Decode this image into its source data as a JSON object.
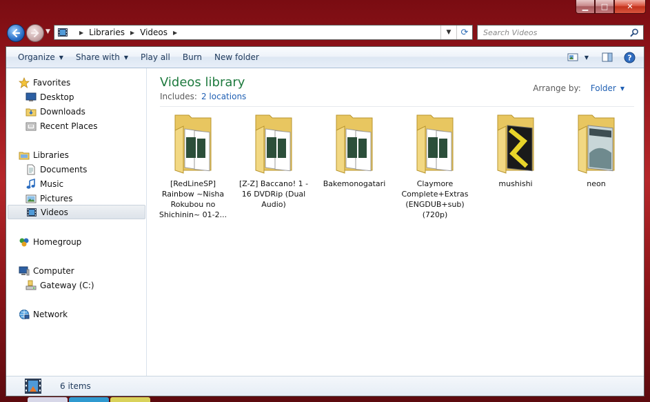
{
  "window": {
    "controls": {
      "minimize": "▁",
      "maximize": "□",
      "close": "✕"
    }
  },
  "address": {
    "crumbs": [
      "Libraries",
      "Videos"
    ],
    "dropdown_glyph": "▼",
    "refresh_glyph": "⟳"
  },
  "search": {
    "placeholder": "Search Videos"
  },
  "toolbar": {
    "organize": "Organize",
    "share_with": "Share with",
    "play_all": "Play all",
    "burn": "Burn",
    "new_folder": "New folder"
  },
  "nav": {
    "favorites": "Favorites",
    "desktop": "Desktop",
    "downloads": "Downloads",
    "recent_places": "Recent Places",
    "libraries": "Libraries",
    "documents": "Documents",
    "music": "Music",
    "pictures": "Pictures",
    "videos": "Videos",
    "homegroup": "Homegroup",
    "computer": "Computer",
    "gateway": "Gateway (C:)",
    "network": "Network"
  },
  "library": {
    "title": "Videos library",
    "includes_label": "Includes:",
    "locations_link": "2 locations",
    "arrange_label": "Arrange by:",
    "arrange_value": "Folder"
  },
  "folders": [
    {
      "name": "[RedLineSP] Rainbow ~Nisha Rokubou no Shichinin~ 01-2...",
      "thumb": "video"
    },
    {
      "name": "[Z-Z] Baccano! 1 - 16 DVDRip (Dual Audio)",
      "thumb": "video"
    },
    {
      "name": "Bakemonogatari",
      "thumb": "video"
    },
    {
      "name": "Claymore Complete+Extras (ENGDUB+sub)(720p)",
      "thumb": "video"
    },
    {
      "name": "mushishi",
      "thumb": "image-dark"
    },
    {
      "name": "neon",
      "thumb": "image-light"
    }
  ],
  "status": {
    "count": "6 items"
  },
  "colors": {
    "accent_green": "#1e7a3e",
    "link_blue": "#1f5fb3",
    "frame_red": "#9e1a1f"
  }
}
